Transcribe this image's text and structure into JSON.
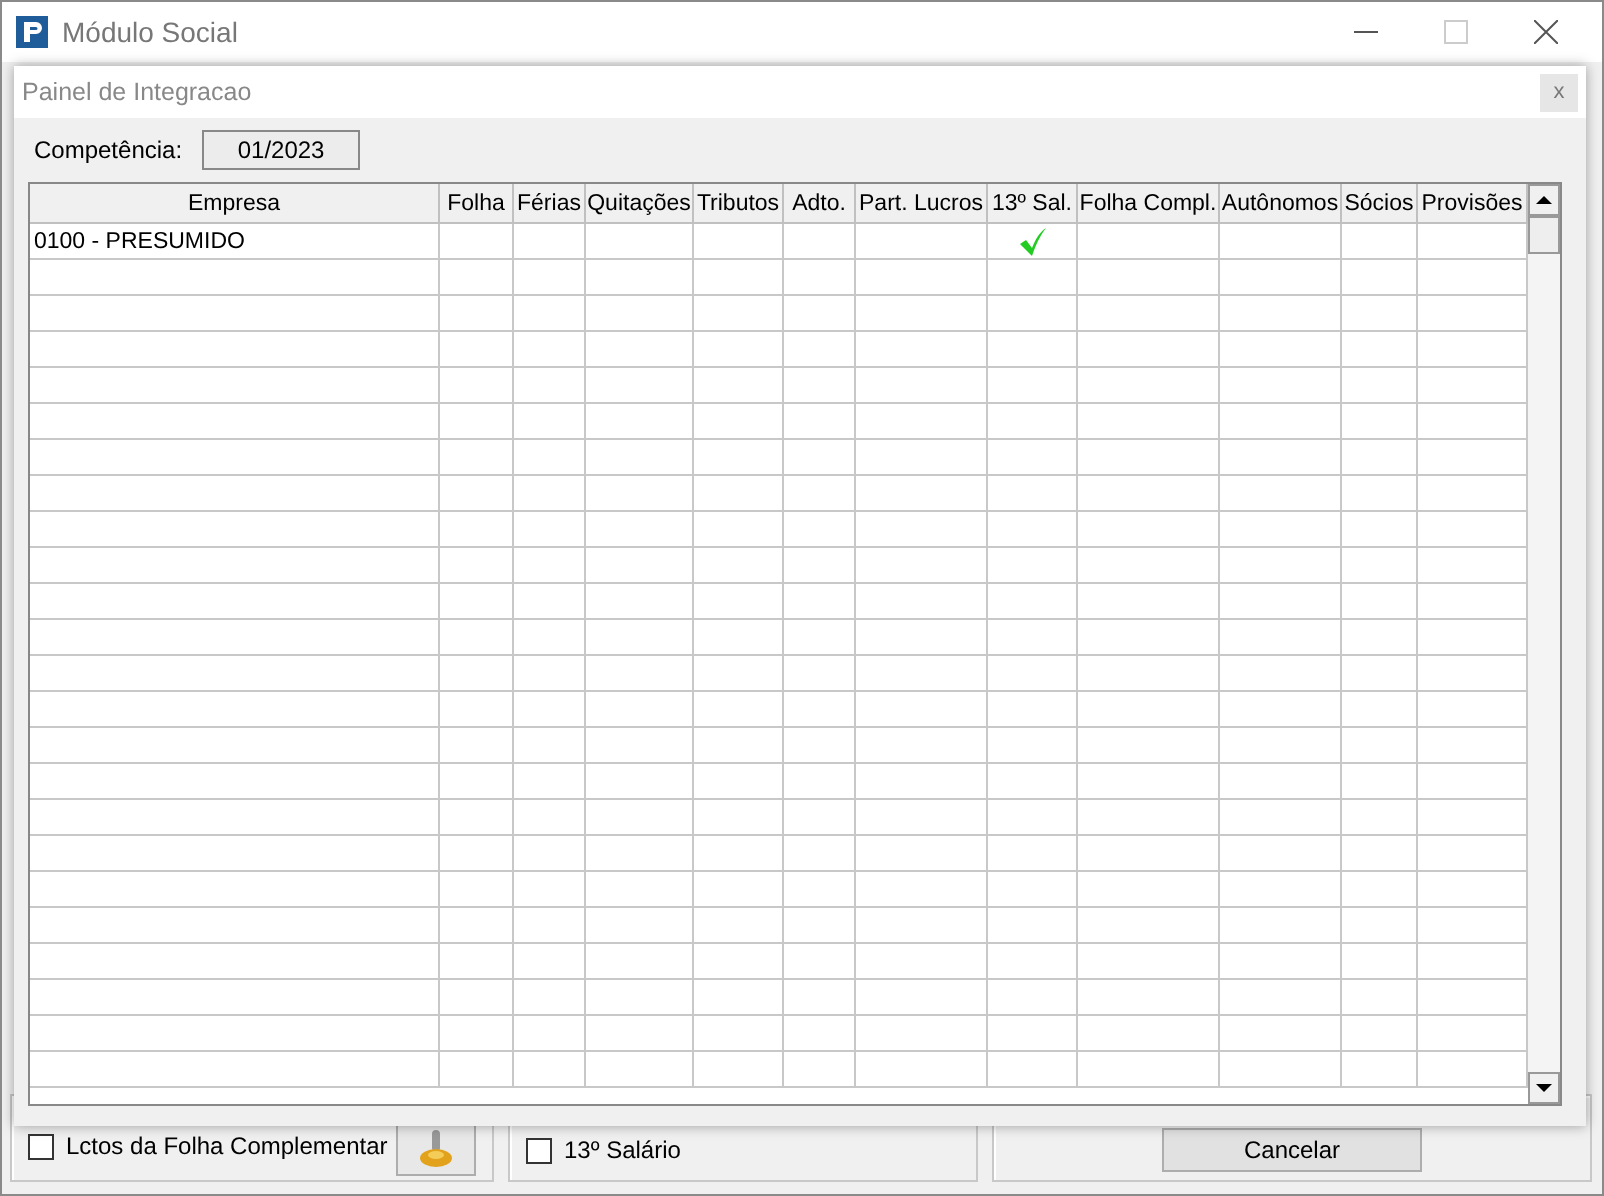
{
  "window": {
    "title": "Módulo Social"
  },
  "dialog": {
    "title": "Painel de Integracao",
    "close": "x"
  },
  "competencia": {
    "label": "Competência:",
    "value": "01/2023"
  },
  "table": {
    "columns": [
      "Empresa",
      "Folha",
      "Férias",
      "Quitações",
      "Tributos",
      "Adto.",
      "Part. Lucros",
      "13º Sal.",
      "Folha Compl.",
      "Autônomos",
      "Sócios",
      "Provisões"
    ],
    "rows": [
      {
        "empresa": "0100 - PRESUMIDO",
        "flags": [
          false,
          false,
          false,
          false,
          false,
          false,
          true,
          false,
          false,
          false,
          false
        ]
      }
    ]
  },
  "background": {
    "checkbox_complementar": {
      "label": "Lctos da Folha Complementar",
      "checked": false
    },
    "checkbox_13": {
      "label": "13º Salário",
      "checked": false
    },
    "cancel_button": "Cancelar"
  }
}
